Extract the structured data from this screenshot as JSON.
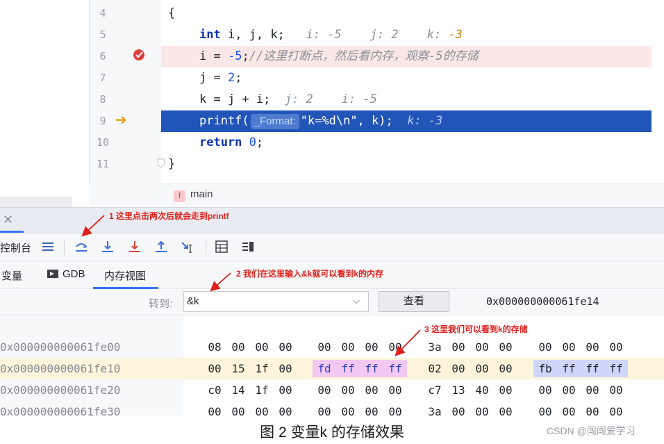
{
  "editor": {
    "lines": [
      {
        "no": "4"
      },
      {
        "no": "5"
      },
      {
        "no": "6"
      },
      {
        "no": "7"
      },
      {
        "no": "8"
      },
      {
        "no": "9"
      },
      {
        "no": "10"
      },
      {
        "no": "11"
      }
    ],
    "code": {
      "l4": "{",
      "l5_kw": "int",
      "l5_rest": " i, j, k;",
      "l5_hint_i": "i: -5",
      "l5_hint_j": "j: 2",
      "l5_hint_k": "k: ",
      "l5_hint_k_val": "-3",
      "l6_a": "i = ",
      "l6_num": "-5",
      "l6_b": ";",
      "l6_comment": "//这里打断点，然后看内存，观察-5的存储",
      "l7_a": "j = ",
      "l7_num": "2",
      "l7_b": ";",
      "l8_code": "k = j + i;",
      "l8_hint_j": "j: 2",
      "l8_hint_i": "i: -5",
      "l9_a": "printf(",
      "l9_param": "_Format:",
      "l9_b": "\"k=%d\\n\", k);",
      "l9_hint": "k: -3",
      "l10_kw": "return",
      "l10_num": "0",
      "l10_b": ";",
      "l11": "}"
    },
    "breadcrumb": {
      "badge": "f",
      "function": "main"
    }
  },
  "debug": {
    "toolbar": {
      "console_label": "控制台"
    },
    "subtabs": {
      "variables": "变量",
      "gdb": "GDB",
      "memory": "内存视图"
    },
    "goto": {
      "label": "转到:",
      "value": "&k",
      "button": "查看",
      "address": "0x000000000061fe14"
    },
    "memory_rows": [
      {
        "addr": "0x000000000061fe00",
        "bytes": [
          "08",
          "00",
          "00",
          "00",
          "00",
          "00",
          "00",
          "00",
          "3a",
          "00",
          "00",
          "00",
          "00",
          "00",
          "00",
          "00"
        ]
      },
      {
        "addr": "0x000000000061fe10",
        "bytes": [
          "00",
          "15",
          "1f",
          "00",
          "fd",
          "ff",
          "ff",
          "ff",
          "02",
          "00",
          "00",
          "00",
          "fb",
          "ff",
          "ff",
          "ff"
        ]
      },
      {
        "addr": "0x000000000061fe20",
        "bytes": [
          "c0",
          "14",
          "1f",
          "00",
          "00",
          "00",
          "00",
          "00",
          "c7",
          "13",
          "40",
          "00",
          "00",
          "00",
          "00",
          "00"
        ]
      },
      {
        "addr": "0x000000000061fe30",
        "bytes": [
          "00",
          "00",
          "00",
          "00",
          "00",
          "00",
          "00",
          "00",
          "3a",
          "00",
          "00",
          "00",
          "00",
          "00",
          "00",
          "00"
        ]
      }
    ]
  },
  "annotations": {
    "a1": "1 这里点击两次后就会走到printf",
    "a2": "2 我们在这里输入&k就可以看到k的内存",
    "a3": "3 这里我们可以看到k的存储"
  },
  "caption": "图 2  变量k 的存储效果",
  "watermark": "CSDN @闯闯爱学习",
  "colors": {
    "exec_line": "#2155b8",
    "breakpoint_line": "#fae8e6",
    "annotation_red": "#e0201b",
    "selected_bytes": "#f2c8f2",
    "i_bytes": "#cfd6fb"
  }
}
